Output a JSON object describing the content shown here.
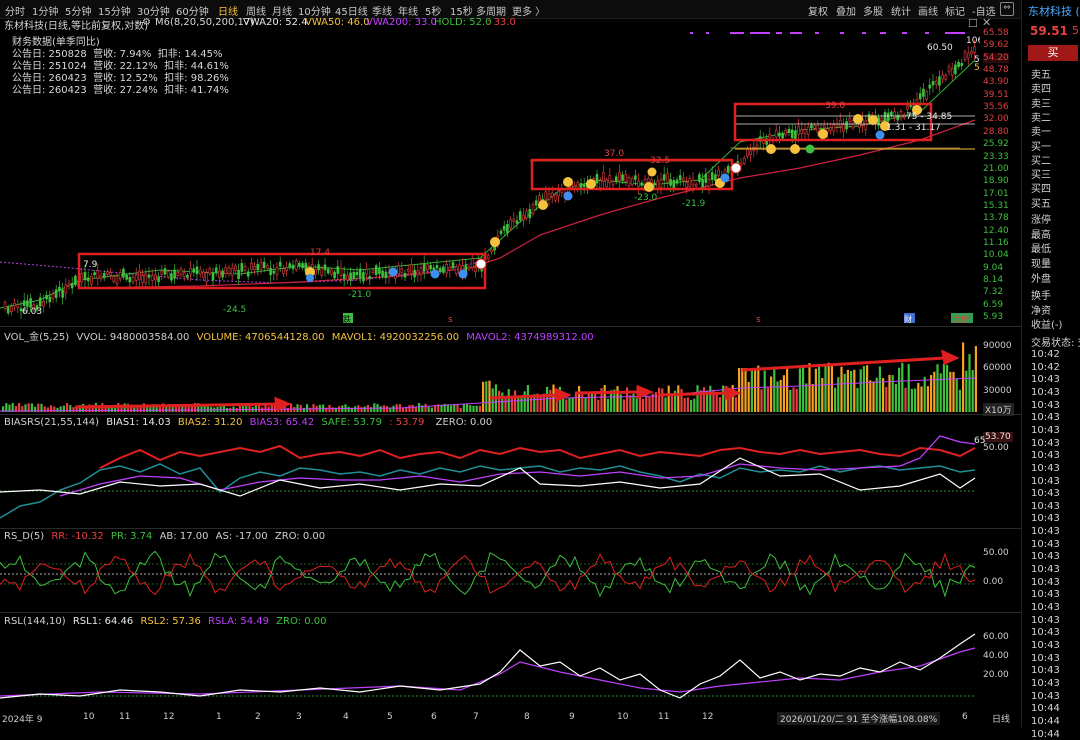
{
  "toolbar": {
    "periods": [
      "分时",
      "1分钟",
      "5分钟",
      "15分钟",
      "30分钟",
      "60分钟",
      "日线",
      "周线",
      "月线",
      "10分钟",
      "45日线",
      "季线",
      "年线",
      "5秒",
      "15秒",
      "多周期",
      "更多 〉"
    ],
    "active_period": "日线",
    "right_items": [
      "复权",
      "叠加",
      "多股",
      "统计",
      "画线",
      "标记",
      "-自选"
    ]
  },
  "stock": {
    "name": "东材科技",
    "title_line": "东材科技(日线,等比前复权,对数)",
    "price": "59.51",
    "price_extra": "5.",
    "header_right": "东材科技 (",
    "buy_button": "买"
  },
  "ma_line": {
    "label": "M6(8,20,50,200,17)",
    "vwa20": "VWA20: 52.4",
    "vwa50": "VWA50: 46.0",
    "vwa200": "VWA200: 33.0",
    "hold": "HOLD: 52.0",
    "hold_val": "33.0"
  },
  "financial": {
    "title": "财务数据(单季同比)",
    "rows": [
      {
        "date": "公告日: 250828",
        "rev_label": "营收:",
        "rev": "7.94%",
        "np_label": "扣非:",
        "np": "14.45%"
      },
      {
        "date": "公告日: 251024",
        "rev_label": "营收:",
        "rev": "22.12%",
        "np_label": "扣非:",
        "np": "44.61%"
      },
      {
        "date": "公告日: 260423",
        "rev_label": "营收:",
        "rev": "12.52%",
        "np_label": "扣非:",
        "np": "98.26%"
      },
      {
        "date": "公告日: 260423",
        "rev_label": "营收:",
        "rev": "27.24%",
        "np_label": "扣非:",
        "np": "41.74%"
      }
    ]
  },
  "price_axis": [
    "65.58",
    "59.62",
    "54.20",
    "48.78",
    "43.90",
    "39.51",
    "35.56",
    "32.00",
    "28.80",
    "25.92",
    "23.33",
    "21.00",
    "18.90",
    "17.01",
    "15.31",
    "13.78",
    "12.40",
    "11.16",
    "10.04",
    "9.04",
    "8.14",
    "7.32",
    "6.59",
    "5.93"
  ],
  "chart_labels": {
    "low_start": "6.03",
    "box1_left": "7.9",
    "box1_high": "17.4",
    "box1_low1": "-24.5",
    "box1_low2": "-21.0",
    "box2_high": "37.0",
    "box2_mid": "32.5",
    "box2_low1": "-23.0",
    "box2_low2": "-21.9",
    "box3_high": "39.0",
    "box3_range1": "75 - 34.85",
    "box3_range2": "1.31 - 31.17",
    "peak_label": "60.50",
    "peak_high": "106",
    "right_56": "56",
    "right_52": "52",
    "mark_die": "跌",
    "mark_s1": "s",
    "mark_s2": "s",
    "mark_cai": "财",
    "mark_longhu": "龙榜"
  },
  "order_book": [
    "卖五",
    "卖四",
    "卖三",
    "卖二",
    "卖一",
    "买一",
    "买二",
    "买三",
    "买四",
    "买五",
    "涨停",
    "最高",
    "最低",
    "现量",
    "外盘",
    "换手",
    "净资",
    "收益(-)",
    "交易状态: 交"
  ],
  "volume": {
    "title": "VOL_金(5,25)",
    "vvol": "VVOL: 9480003584.00",
    "volume": "VOLUME: 4706544128.00",
    "mavol1": "MAVOL1: 4920032256.00",
    "mavol2": "MAVOL2: 4374989312.00",
    "axis": [
      "90000",
      "60000",
      "30000"
    ],
    "unit": "X10万"
  },
  "biasrs": {
    "title": "BIASRS(21,55,144)",
    "bias1": "BIAS1: 14.03",
    "bias2": "BIAS2: 31.20",
    "bias3": "BIAS3: 65.42",
    "safe": "SAFE: 53.79",
    "safe_val": "53.79",
    "zero": "ZERO: 0.00",
    "badge": "53.70",
    "axis": "50.00",
    "right_65": "65"
  },
  "rsd": {
    "title": "RS_D(5)",
    "rr": "RR: -10.32",
    "pr": "PR: 3.74",
    "ab": "AB: 17.00",
    "as": "AS: -17.00",
    "zro": "ZRO: 0.00",
    "axis": [
      "50.00",
      "0.00"
    ]
  },
  "rsl": {
    "title": "RSL(144,10)",
    "rsl1": "RSL1: 64.46",
    "rsl2": "RSL2: 57.36",
    "rsla": "RSLA: 54.49",
    "zro": "ZRO: 0.00",
    "axis": [
      "60.00",
      "40.00",
      "20.00"
    ]
  },
  "time_column": [
    "10:42",
    "10:42",
    "10:43",
    "10:43",
    "10:43",
    "10:43",
    "10:43",
    "10:43",
    "10:43",
    "10:43",
    "10:43",
    "10:43",
    "10:43",
    "10:43",
    "10:43",
    "10:43",
    "10:43",
    "10:43",
    "10:43",
    "10:43",
    "10:43",
    "10:43",
    "10:43",
    "10:43",
    "10:43",
    "10:43",
    "10:43",
    "10:43",
    "10:44",
    "10:44",
    "10:44"
  ],
  "x_axis": [
    "2024年 9",
    "10",
    "11",
    "12",
    "1",
    "2",
    "3",
    "4",
    "5",
    "6",
    "7",
    "8",
    "9",
    "10",
    "11",
    "12",
    "2026/01/20/二 91 至今涨幅108.08%",
    "6",
    "日线"
  ],
  "colors": {
    "up": "#e84040",
    "down": "#3ec03e",
    "yellow": "#f6c23e",
    "purple": "#c040ff",
    "box": "#e02020"
  }
}
